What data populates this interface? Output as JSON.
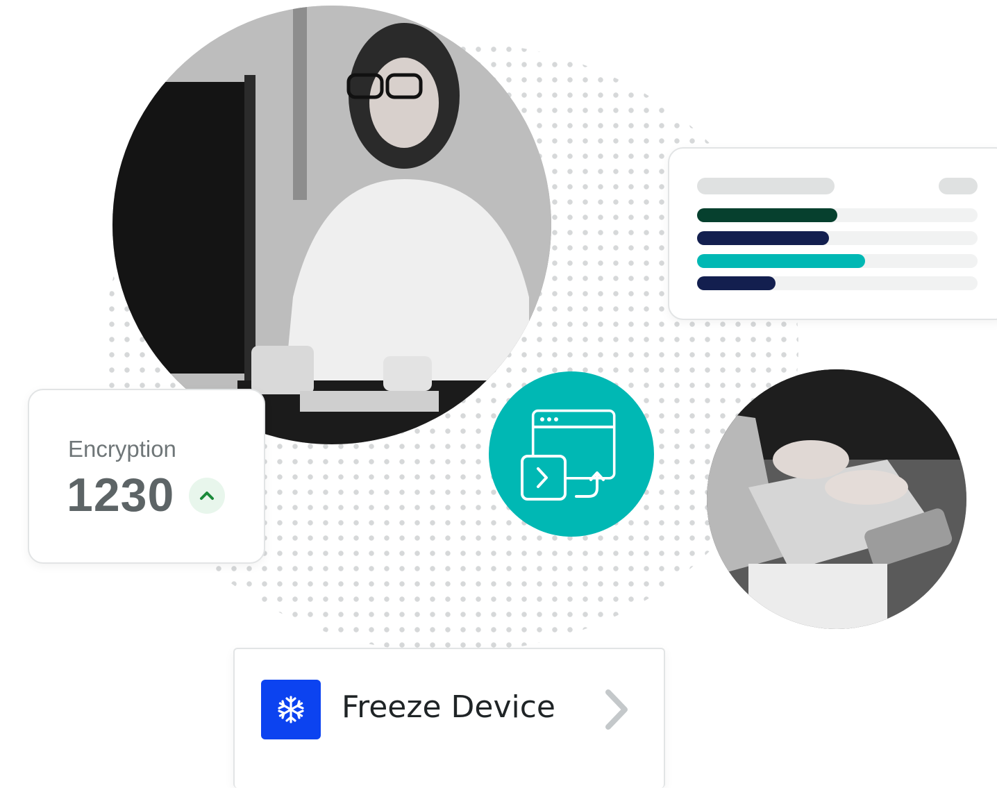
{
  "metric": {
    "label": "Encryption",
    "value": "1230",
    "trend": "up",
    "trend_icon": "chevron-up-icon",
    "trend_color": "#1b8a3a"
  },
  "progress_panel": {
    "bars": [
      {
        "fill": 0.5,
        "color": "#06402e"
      },
      {
        "fill": 0.47,
        "color": "#131f4f"
      },
      {
        "fill": 0.6,
        "color": "#00b8b4"
      },
      {
        "fill": 0.28,
        "color": "#131f4f"
      }
    ]
  },
  "app_badge": {
    "icon": "terminal-window-upload-icon",
    "color": "#00b8b4"
  },
  "action": {
    "label": "Freeze Device",
    "icon": "snowflake-icon",
    "icon_bg": "#0c43f0",
    "chevron": "chevron-right-icon"
  },
  "photos": {
    "main": "woman-at-computer-photo",
    "side": "hands-on-laptop-photo"
  }
}
